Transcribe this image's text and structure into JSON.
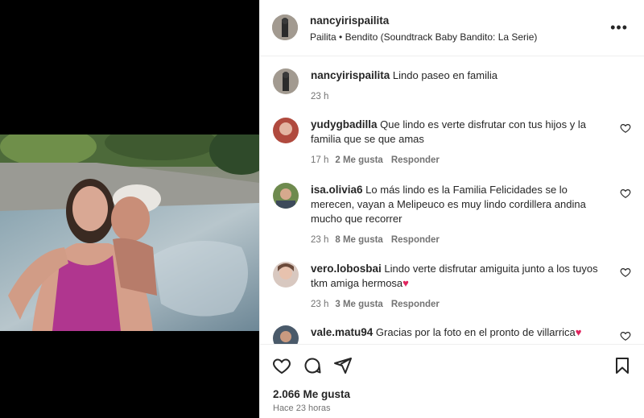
{
  "post": {
    "username": "nancyirispailita",
    "location": "Pailita",
    "separator": "•",
    "audio": "Bendito (Soundtrack Baby Bandito: La Serie)",
    "more_icon": "more-icon"
  },
  "caption": {
    "username": "nancyirispailita",
    "text": "Lindo paseo en familia",
    "time": "23 h"
  },
  "comments": [
    {
      "username": "yudygbadilla",
      "text": "Que lindo es verte disfrutar con tus hijos y la familia que se que amas",
      "time": "17 h",
      "likes": "2 Me gusta",
      "reply": "Responder"
    },
    {
      "username": "isa.olivia6",
      "text": "Lo más lindo es la Familia Felicidades se lo merecen, vayan a Melipeuco es muy lindo cordillera andina mucho que recorrer",
      "time": "23 h",
      "likes": "8 Me gusta",
      "reply": "Responder"
    },
    {
      "username": "vero.lobosbai",
      "text": "Lindo verte disfrutar amiguita junto a los tuyos tkm amiga hermosa",
      "emoji": "♥",
      "time": "23 h",
      "likes": "3 Me gusta",
      "reply": "Responder"
    },
    {
      "username": "vale.matu94",
      "text": "Gracias por la foto en el pronto de villarrica",
      "emoji": "♥"
    }
  ],
  "footer": {
    "likes": "2.066 Me gusta",
    "time": "Hace 23 horas"
  },
  "colors": {
    "text": "#262626",
    "muted": "#737373",
    "heart": "#e0245e",
    "divider": "#efefef"
  }
}
